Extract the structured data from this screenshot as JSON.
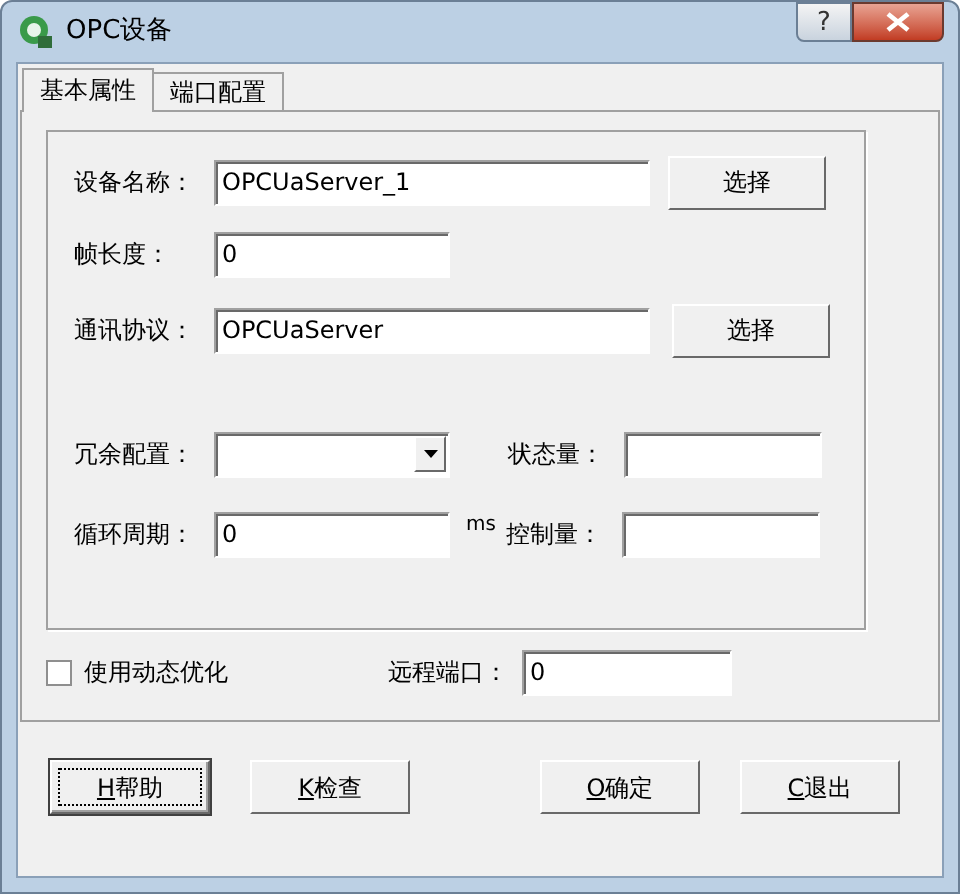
{
  "window": {
    "title": "OPC设备",
    "help_button": "?"
  },
  "tabs": [
    {
      "label": "基本属性",
      "selected": true
    },
    {
      "label": "端口配置",
      "selected": false
    }
  ],
  "device_name": {
    "label": "设备名称：",
    "value": "OPCUaServer_1",
    "button": "选择"
  },
  "frame_length": {
    "label": "帧长度：",
    "value": "0"
  },
  "protocol": {
    "label": "通讯协议：",
    "value": "OPCUaServer",
    "button": "选择"
  },
  "redundancy": {
    "label": "冗余配置："
  },
  "status_var": {
    "label": "状态量："
  },
  "cycle": {
    "label": "循环周期：",
    "value": "0",
    "unit": "ms"
  },
  "control_var": {
    "label": "控制量："
  },
  "dynamic_optimization": {
    "label": "使用动态优化",
    "checked": false
  },
  "remote_port": {
    "label": "远程端口：",
    "value": "0"
  },
  "buttons": [
    {
      "key": "H",
      "label": "帮助",
      "focused": true
    },
    {
      "key": "K",
      "label": "检查",
      "focused": false
    },
    {
      "key": "O",
      "label": "确定",
      "focused": false
    },
    {
      "key": "C",
      "label": "退出",
      "focused": false
    }
  ]
}
